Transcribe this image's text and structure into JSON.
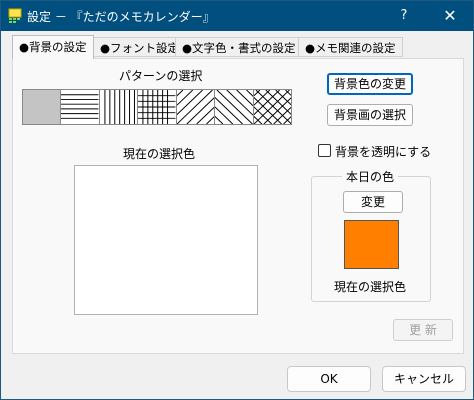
{
  "window": {
    "title": "設定 － 『ただのメモカレンダー』",
    "help": "?",
    "close": "✕"
  },
  "tabs": [
    {
      "label": "●背景の設定",
      "active": true
    },
    {
      "label": "●フォント設定",
      "active": false
    },
    {
      "label": "●文字色・書式の設定",
      "active": false
    },
    {
      "label": "●メモ関連の設定",
      "active": false
    }
  ],
  "background": {
    "pattern_title": "パターンの選択",
    "patterns": [
      "solid",
      "horizontal",
      "vertical",
      "cross",
      "diagonal-forward",
      "diagonal-backward",
      "diagonal-cross"
    ],
    "selected_pattern": "solid",
    "preview_title": "現在の選択色",
    "btn_bg_color": "背景色の変更",
    "btn_bg_image": "背景画の選択",
    "transparent_label": "背景を透明にする",
    "transparent_checked": false
  },
  "today_group": {
    "title": "本日の色",
    "change_button": "変更",
    "current_label": "現在の選択色",
    "color": "#ff7f00"
  },
  "update_button": "更 新",
  "footer": {
    "ok": "OK",
    "cancel": "キャンセル"
  }
}
